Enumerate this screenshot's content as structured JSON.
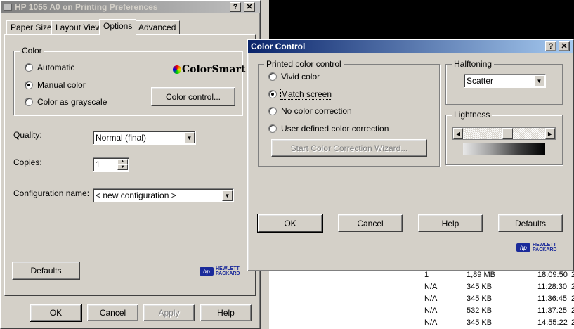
{
  "background": {
    "rows": [
      {
        "c1": "1",
        "c2": "1,89 MB",
        "c3": "18:09:50",
        "c4": "2"
      },
      {
        "c1": "N/A",
        "c2": "345 KB",
        "c3": "11:28:30",
        "c4": "2"
      },
      {
        "c1": "N/A",
        "c2": "345 KB",
        "c3": "11:36:45",
        "c4": "2"
      },
      {
        "c1": "N/A",
        "c2": "532 KB",
        "c3": "11:37:25",
        "c4": "2"
      },
      {
        "c1": "N/A",
        "c2": "345 KB",
        "c3": "14:55:22",
        "c4": "2"
      }
    ]
  },
  "prefs": {
    "title": "HP 1055 A0 on                Printing Preferences",
    "tabs": [
      "Paper Size",
      "Layout View",
      "Options",
      "Advanced"
    ],
    "color_group": "Color",
    "radios": [
      {
        "label": "Automatic",
        "checked": false
      },
      {
        "label": "Manual color",
        "checked": true
      },
      {
        "label": "Color as grayscale",
        "checked": false
      }
    ],
    "colorsmart": "ColorSmart",
    "color_control_btn": "Color control...",
    "quality_label": "Quality:",
    "quality_value": "Normal (final)",
    "copies_label": "Copies:",
    "copies_value": "1",
    "config_label": "Configuration name:",
    "config_value": "< new configuration >",
    "defaults_btn": "Defaults",
    "ok_btn": "OK",
    "cancel_btn": "Cancel",
    "apply_btn": "Apply",
    "help_btn": "Help",
    "hp_line1": "HEWLETT",
    "hp_line2": "PACKARD",
    "hp_badge": "hp"
  },
  "cc": {
    "title": "Color Control",
    "printed_group": "Printed color control",
    "radios": [
      {
        "label": "Vivid color",
        "checked": false
      },
      {
        "label": "Match screen",
        "checked": true
      },
      {
        "label": "No color correction",
        "checked": false
      },
      {
        "label": "User defined color correction",
        "checked": false
      }
    ],
    "wizard_btn": "Start Color Correction Wizard...",
    "halftoning_group": "Halftoning",
    "halftoning_value": "Scatter",
    "lightness_group": "Lightness",
    "lightness_level": 0.55,
    "ok_btn": "OK",
    "cancel_btn": "Cancel",
    "help_btn": "Help",
    "defaults_btn": "Defaults",
    "hp_line1": "HEWLETT",
    "hp_line2": "PACKARD",
    "hp_badge": "hp"
  },
  "colors": {
    "active_title": "#0a246a",
    "inactive_title": "#808080",
    "hp_blue": "#1a2a9a"
  }
}
